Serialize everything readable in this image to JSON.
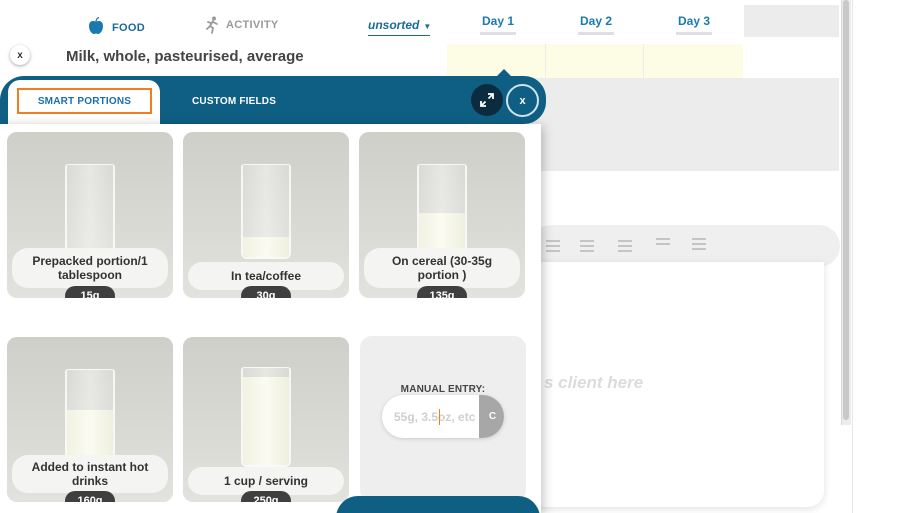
{
  "food_tabs": {
    "food_label": "FOOD",
    "activity_label": "ACTIVITY",
    "sort_value": "unsorted"
  },
  "food_name": "Milk, whole, pasteurised, average",
  "close_small_label": "x",
  "days": [
    "Day 1",
    "Day 2",
    "Day 3"
  ],
  "editor_placeholder": "s client here",
  "modal": {
    "tabs": {
      "smart_portions": "SMART PORTIONS",
      "custom_fields": "CUSTOM FIELDS"
    },
    "close_label": "x",
    "portions": [
      {
        "label": "Prepacked portion/1 tablespoon",
        "weight": "15g"
      },
      {
        "label": "In tea/coffee",
        "weight": "30g"
      },
      {
        "label": "On cereal (30-35g portion )",
        "weight": "135g"
      },
      {
        "label": "Added to instant hot drinks",
        "weight": "160g"
      },
      {
        "label": "1 cup / serving",
        "weight": "250g"
      }
    ],
    "manual_entry": {
      "title": "MANUAL ENTRY:",
      "placeholder": "55g, 3.5oz, etc",
      "button_label": "C"
    }
  },
  "colors": {
    "brand_blue": "#0f5f85",
    "accent_orange": "#ee7d23",
    "link_blue": "#1a6fb0"
  }
}
